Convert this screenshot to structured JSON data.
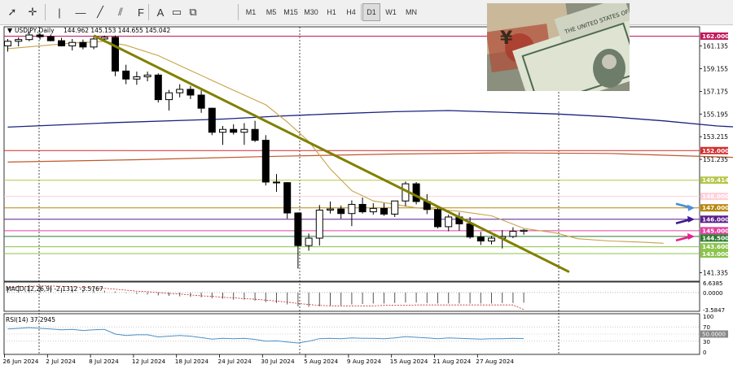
{
  "toolbar": {
    "buttons": [
      {
        "name": "cursor-icon",
        "glyph": "➚"
      },
      {
        "name": "crosshair-icon",
        "glyph": "✛"
      },
      {
        "name": "vertical-line-icon",
        "glyph": "|"
      },
      {
        "name": "horizontal-line-icon",
        "glyph": "—"
      },
      {
        "name": "trendline-icon",
        "glyph": "╱"
      },
      {
        "name": "equidistant-channel-icon",
        "glyph": "⫽"
      },
      {
        "name": "fibonacci-icon",
        "glyph": "F"
      },
      {
        "name": "text-icon",
        "glyph": "A"
      },
      {
        "name": "label-icon",
        "glyph": "▭"
      },
      {
        "name": "shapes-icon",
        "glyph": "⧉"
      }
    ],
    "timeframes": [
      "M1",
      "M5",
      "M15",
      "M30",
      "H1",
      "H4",
      "D1",
      "W1",
      "MN"
    ],
    "active_timeframe": "D1"
  },
  "header": {
    "symbol": "USDJPY,Daily",
    "ohlc": "144.962 145.153 144.655 145.042"
  },
  "price_axis": {
    "ticks": [
      "161.135",
      "159.155",
      "157.175",
      "155.195",
      "153.215",
      "151.235",
      "141.335"
    ],
    "level_labels": [
      {
        "text": "162.000",
        "color": "#c2185b"
      },
      {
        "text": "152.000",
        "color": "#d32f2f"
      },
      {
        "text": "149.414",
        "color": "#b7c74a"
      },
      {
        "text": "148.000",
        "color": "#ffd0d8"
      },
      {
        "text": "147.000",
        "color": "#b8860b"
      },
      {
        "text": "146.000",
        "color": "#5a1e8c"
      },
      {
        "text": "145.000",
        "color": "#e040a0"
      },
      {
        "text": "144.500",
        "color": "#2e7d32"
      },
      {
        "text": "143.600",
        "color": "#8bc34a"
      },
      {
        "text": "143.000",
        "color": "#8bc34a"
      }
    ]
  },
  "macd": {
    "label": "MACD(12,26,9) -2.1312 -3.5767",
    "ticks": [
      "6.6385",
      "0.0000",
      "-3.5847"
    ]
  },
  "rsi": {
    "label": "RSI(14) 37.2945",
    "ticks": [
      "100",
      "70",
      "50.0000",
      "30",
      "0"
    ]
  },
  "time_axis": [
    "26 Jun 2024",
    "2 Jul 2024",
    "8 Jul 2024",
    "12 Jul 2024",
    "18 Jul 2024",
    "24 Jul 2024",
    "30 Jul 2024",
    "5 Aug 2024",
    "9 Aug 2024",
    "15 Aug 2024",
    "21 Aug 2024",
    "27 Aug 2024"
  ],
  "candles": [
    [
      161.15,
      161.75,
      160.65,
      161.55
    ],
    [
      161.55,
      161.9,
      161.1,
      161.7
    ],
    [
      161.7,
      162.4,
      161.55,
      162.1
    ],
    [
      162.1,
      162.25,
      161.7,
      161.95
    ],
    [
      161.95,
      162.15,
      161.55,
      161.6
    ],
    [
      161.6,
      161.85,
      161.1,
      161.15
    ],
    [
      161.15,
      161.75,
      160.75,
      161.45
    ],
    [
      161.45,
      161.7,
      160.85,
      161.05
    ],
    [
      161.05,
      161.95,
      160.85,
      161.75
    ],
    [
      161.75,
      162.05,
      161.45,
      161.9
    ],
    [
      161.9,
      162.05,
      158.5,
      158.95
    ],
    [
      158.95,
      159.5,
      157.8,
      158.25
    ],
    [
      158.25,
      158.9,
      157.75,
      158.45
    ],
    [
      158.45,
      158.9,
      158.05,
      158.6
    ],
    [
      158.6,
      158.75,
      156.2,
      156.45
    ],
    [
      156.45,
      157.3,
      155.5,
      157.05
    ],
    [
      157.05,
      157.8,
      156.65,
      157.35
    ],
    [
      157.35,
      157.65,
      156.5,
      156.85
    ],
    [
      156.85,
      157.25,
      155.3,
      155.7
    ],
    [
      155.7,
      155.75,
      153.35,
      153.6
    ],
    [
      153.6,
      154.15,
      152.5,
      153.85
    ],
    [
      153.85,
      154.3,
      153.4,
      153.6
    ],
    [
      153.6,
      154.4,
      152.5,
      153.85
    ],
    [
      153.85,
      154.6,
      152.75,
      152.9
    ],
    [
      152.9,
      153.35,
      148.95,
      149.25
    ],
    [
      149.25,
      149.95,
      148.4,
      149.2
    ],
    [
      149.2,
      149.25,
      146.05,
      146.55
    ],
    [
      146.55,
      146.6,
      141.7,
      143.7
    ],
    [
      143.7,
      144.75,
      143.25,
      144.35
    ],
    [
      144.35,
      147.25,
      143.7,
      146.8
    ],
    [
      146.8,
      147.55,
      146.5,
      146.9
    ],
    [
      146.9,
      147.2,
      146.05,
      146.5
    ],
    [
      146.5,
      147.65,
      145.4,
      147.3
    ],
    [
      147.3,
      147.9,
      146.5,
      146.65
    ],
    [
      146.65,
      147.4,
      146.4,
      146.95
    ],
    [
      146.95,
      147.4,
      146.3,
      146.45
    ],
    [
      146.45,
      147.45,
      146.2,
      147.6
    ],
    [
      147.6,
      149.3,
      147.15,
      149.1
    ],
    [
      149.1,
      149.25,
      147.3,
      147.55
    ],
    [
      147.55,
      148.2,
      146.45,
      146.85
    ],
    [
      146.85,
      147.0,
      145.2,
      145.35
    ],
    [
      145.35,
      146.4,
      144.95,
      146.2
    ],
    [
      146.2,
      146.6,
      145.0,
      145.6
    ],
    [
      145.6,
      146.2,
      144.3,
      144.45
    ],
    [
      144.45,
      144.9,
      143.75,
      144.1
    ],
    [
      144.1,
      144.55,
      143.8,
      144.35
    ],
    [
      144.35,
      145.05,
      143.45,
      144.5
    ],
    [
      144.5,
      145.3,
      144.35,
      144.95
    ],
    [
      144.95,
      145.15,
      144.65,
      145.04
    ]
  ],
  "chart": {
    "y_range": [
      140.8,
      162.6
    ],
    "trendline": {
      "from": [
        "8 Jul 2024",
        162.05
      ],
      "to": [
        "2 Sep 2024",
        141.4
      ],
      "color": "#808000"
    },
    "ma_slow": {
      "color": "#1a237e",
      "points": [
        [
          0,
          154.05
        ],
        [
          10,
          154.45
        ],
        [
          20,
          154.75
        ],
        [
          25,
          155.0
        ],
        [
          30,
          155.2
        ],
        [
          36,
          155.4
        ],
        [
          41,
          155.5
        ],
        [
          46,
          155.35
        ],
        [
          51,
          155.2
        ],
        [
          56,
          154.95
        ],
        [
          61,
          154.6
        ],
        [
          66,
          154.15
        ],
        [
          71,
          153.9
        ]
      ]
    },
    "ma_mid": {
      "color": "#c0582a",
      "points": [
        [
          0,
          151.0
        ],
        [
          12,
          151.2
        ],
        [
          25,
          151.5
        ],
        [
          36,
          151.7
        ],
        [
          46,
          151.8
        ],
        [
          56,
          151.75
        ],
        [
          66,
          151.45
        ],
        [
          71,
          151.3
        ]
      ]
    },
    "ma_fast": {
      "color": "#c8a24a",
      "points": [
        [
          0,
          160.9
        ],
        [
          6,
          161.4
        ],
        [
          9,
          161.55
        ],
        [
          11,
          161.2
        ],
        [
          14,
          160.3
        ],
        [
          17,
          159.0
        ],
        [
          20,
          157.7
        ],
        [
          24,
          156.0
        ],
        [
          26,
          154.5
        ],
        [
          28,
          152.8
        ],
        [
          30,
          150.4
        ],
        [
          32,
          148.5
        ],
        [
          34,
          147.6
        ],
        [
          38,
          147.0
        ],
        [
          42,
          146.7
        ],
        [
          45,
          146.3
        ],
        [
          48,
          145.2
        ],
        [
          51,
          144.8
        ],
        [
          53,
          144.3
        ],
        [
          56,
          144.1
        ],
        [
          59,
          144.0
        ],
        [
          61,
          143.9
        ]
      ]
    },
    "macd_hist": [
      1.2,
      1.5,
      1.6,
      1.5,
      1.3,
      1.0,
      0.8,
      0.6,
      0.5,
      0.4,
      0.2,
      -0.1,
      -0.3,
      -0.4,
      -0.6,
      -0.7,
      -0.8,
      -0.9,
      -1.0,
      -1.2,
      -1.3,
      -1.5,
      -1.5,
      -1.7,
      -2.0,
      -2.2,
      -2.5,
      -2.9,
      -3.0,
      -2.9,
      -2.8,
      -2.7,
      -2.5,
      -2.4,
      -2.3,
      -2.3,
      -2.2,
      -2.1,
      -2.1,
      -2.2,
      -2.3,
      -2.3,
      -2.3,
      -2.3,
      -2.3,
      -2.3,
      -2.2,
      -2.2,
      -2.13
    ],
    "macd_signal": [
      1.0,
      1.2,
      1.3,
      1.4,
      1.4,
      1.3,
      1.2,
      1.1,
      1.0,
      0.9,
      0.7,
      0.5,
      0.3,
      0.2,
      0.0,
      -0.2,
      -0.3,
      -0.5,
      -0.7,
      -0.8,
      -1.0,
      -1.1,
      -1.3,
      -1.4,
      -1.6,
      -1.8,
      -2.0,
      -2.3,
      -2.5,
      -2.7,
      -2.8,
      -2.8,
      -2.8,
      -2.8,
      -2.8,
      -2.7,
      -2.7,
      -2.7,
      -2.6,
      -2.6,
      -2.6,
      -2.6,
      -2.6,
      -2.6,
      -2.6,
      -2.6,
      -2.6,
      -2.6,
      -3.58
    ],
    "rsi_values": [
      64,
      66,
      68,
      66,
      64,
      62,
      63,
      60,
      62,
      63,
      50,
      46,
      48,
      48,
      42,
      44,
      46,
      44,
      40,
      36,
      38,
      37,
      38,
      35,
      30,
      31,
      28,
      25,
      30,
      37,
      38,
      37,
      39,
      38,
      38,
      37,
      39,
      43,
      41,
      39,
      37,
      39,
      38,
      37,
      36,
      37,
      37,
      38,
      37.3
    ]
  }
}
